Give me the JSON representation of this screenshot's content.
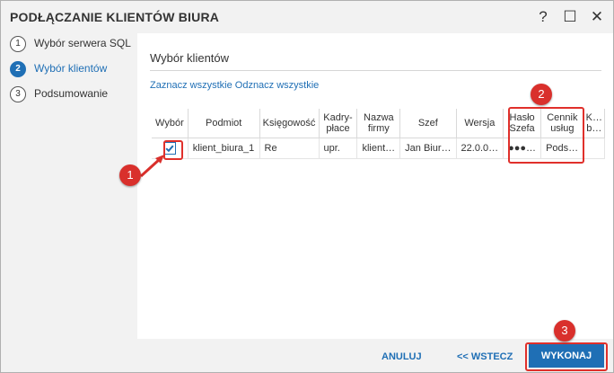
{
  "window": {
    "title": "PODŁĄCZANIE KLIENTÓW BIURA",
    "help_label": "?",
    "maximize_label": "☐",
    "close_label": "✕"
  },
  "steps": [
    {
      "num": "1",
      "label": "Wybór serwera SQL",
      "active": false
    },
    {
      "num": "2",
      "label": "Wybór klientów",
      "active": true
    },
    {
      "num": "3",
      "label": "Podsumowanie",
      "active": false
    }
  ],
  "main": {
    "section_title": "Wybór klientów",
    "select_all": "Zaznacz wszystkie",
    "deselect_all": "Odznacz wszystkie"
  },
  "table": {
    "headers": [
      "Wybór",
      "Podmiot",
      "Księgowość",
      "Kadry-\npłace",
      "Nazwa\nfirmy",
      "Szef",
      "Wersja",
      "Hasło\nSzefa",
      "Cennik\nusług",
      "K…\nb…"
    ],
    "row": {
      "checked": true,
      "cells": [
        "klient_biura_1",
        "Re",
        "upr.",
        "klient…",
        "Jan Biur…",
        "22.0.0…",
        "●●●…",
        "Pods…",
        ""
      ]
    }
  },
  "annotations": {
    "badge1": "1",
    "badge2": "2",
    "badge3": "3",
    "color": "#d9302c"
  },
  "footer": {
    "cancel": "ANULUJ",
    "back": "<< WSTECZ",
    "execute": "WYKONAJ"
  },
  "colors": {
    "accent": "#1f6fb5",
    "annotation_red": "#e0302b"
  }
}
